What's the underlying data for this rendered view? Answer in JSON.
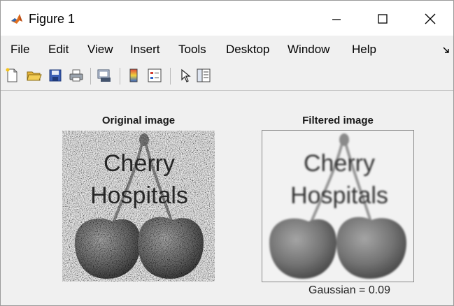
{
  "window": {
    "title": "Figure 1"
  },
  "menu": {
    "items": [
      "File",
      "Edit",
      "View",
      "Insert",
      "Tools",
      "Desktop",
      "Window",
      "Help"
    ]
  },
  "toolbar": {
    "icons": [
      "new-figure-icon",
      "open-file-icon",
      "save-icon",
      "print-icon",
      "link-figure-icon",
      "colorbar-icon",
      "legend-icon",
      "edit-plot-icon",
      "property-editor-icon"
    ]
  },
  "axes": [
    {
      "title": "Original image",
      "image_text": [
        "Cherry",
        "Hospitals"
      ]
    },
    {
      "title": "Filtered image",
      "image_text": [
        "Cherry",
        "Hospitals"
      ],
      "xlabel": "Gaussian = 0.09"
    }
  ]
}
